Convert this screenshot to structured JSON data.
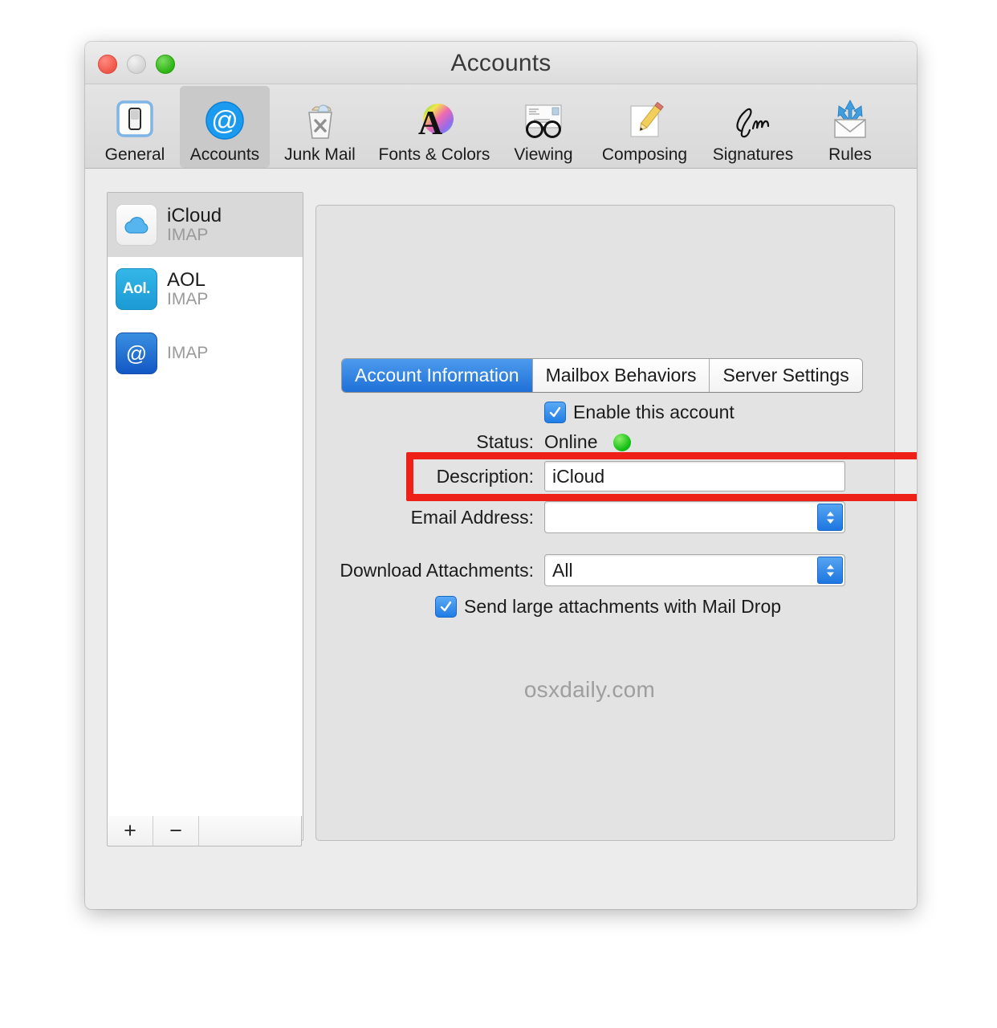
{
  "window": {
    "title": "Accounts",
    "traffic_lights": [
      {
        "name": "close",
        "color": "#f0564a"
      },
      {
        "name": "minimize",
        "color": "#d4d4d4"
      },
      {
        "name": "zoom",
        "color": "#2eb314"
      }
    ]
  },
  "toolbar": {
    "items": [
      {
        "label": "General",
        "icon": "switch-icon",
        "selected": false
      },
      {
        "label": "Accounts",
        "icon": "at-sign-icon",
        "selected": true
      },
      {
        "label": "Junk Mail",
        "icon": "trash-x-icon",
        "selected": false
      },
      {
        "label": "Fonts & Colors",
        "icon": "font-color-icon",
        "selected": false
      },
      {
        "label": "Viewing",
        "icon": "glasses-icon",
        "selected": false
      },
      {
        "label": "Composing",
        "icon": "pencil-icon",
        "selected": false
      },
      {
        "label": "Signatures",
        "icon": "signature-icon",
        "selected": false
      },
      {
        "label": "Rules",
        "icon": "rules-icon",
        "selected": false
      }
    ]
  },
  "sidebar": {
    "accounts": [
      {
        "name": "iCloud",
        "protocol": "IMAP",
        "icon": "icloud-icon",
        "selected": true
      },
      {
        "name": "AOL",
        "protocol": "IMAP",
        "icon": "aol-icon",
        "selected": false
      },
      {
        "name": "",
        "protocol": "IMAP",
        "icon": "at-sign-icon",
        "selected": false
      }
    ],
    "footer": {
      "add_label": "+",
      "remove_label": "−"
    }
  },
  "tabs": [
    {
      "label": "Account Information",
      "active": true
    },
    {
      "label": "Mailbox Behaviors",
      "active": false
    },
    {
      "label": "Server Settings",
      "active": false
    }
  ],
  "form": {
    "enable_account_label": "Enable this account",
    "status_label": "Status:",
    "status_value": "Online",
    "status_color": "#14bf14",
    "description_label": "Description:",
    "description_value": "iCloud",
    "email_label": "Email Address:",
    "email_value": "",
    "download_attachments_label": "Download Attachments:",
    "download_attachments_value": "All",
    "mail_drop_label": "Send large attachments with Mail Drop"
  },
  "highlight": {
    "color": "#ee2119",
    "target": "download-attachments-row"
  },
  "watermark": "osxdaily.com",
  "help_button_label": "?"
}
